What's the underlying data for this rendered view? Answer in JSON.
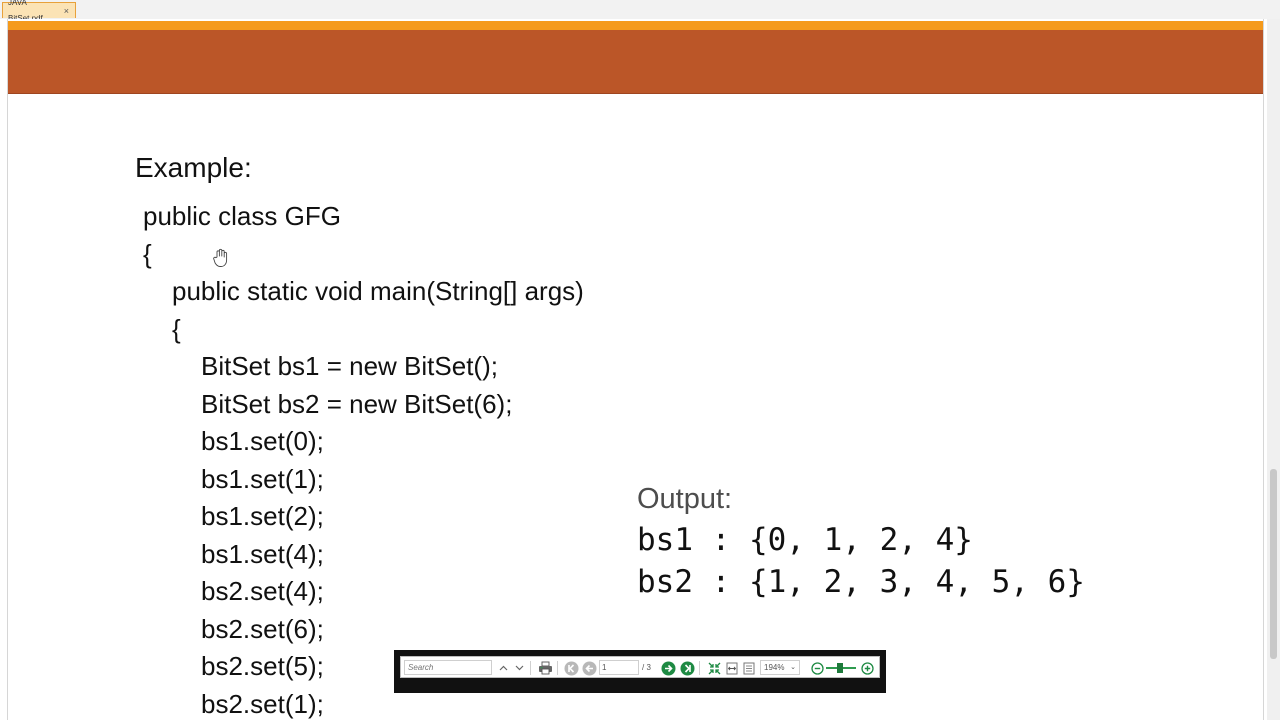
{
  "tab": {
    "title": "JAVA BitSet.pdf",
    "close": "×"
  },
  "document": {
    "heading": "Example:",
    "code_lines": [
      "public class GFG",
      "{",
      "public static void main(String[] args)",
      "{",
      "BitSet bs1 = new BitSet();",
      "BitSet bs2 = new BitSet(6);",
      "bs1.set(0);",
      "bs1.set(1);",
      "bs1.set(2);",
      "bs1.set(4);",
      "bs2.set(4);",
      "bs2.set(6);",
      "bs2.set(5);",
      "bs2.set(1);"
    ],
    "output_title": "Output:",
    "output_lines": [
      "bs1 : {0, 1, 2, 4}",
      "bs2 : {1, 2, 3, 4, 5, 6}"
    ]
  },
  "toolbar": {
    "search_placeholder": "Search",
    "current_page": "1",
    "total_pages": "/ 3",
    "zoom": "194%"
  },
  "colors": {
    "banner": "#bb5628",
    "banner_stripe": "#f59a1c",
    "toolbar_green": "#1e8a43"
  }
}
